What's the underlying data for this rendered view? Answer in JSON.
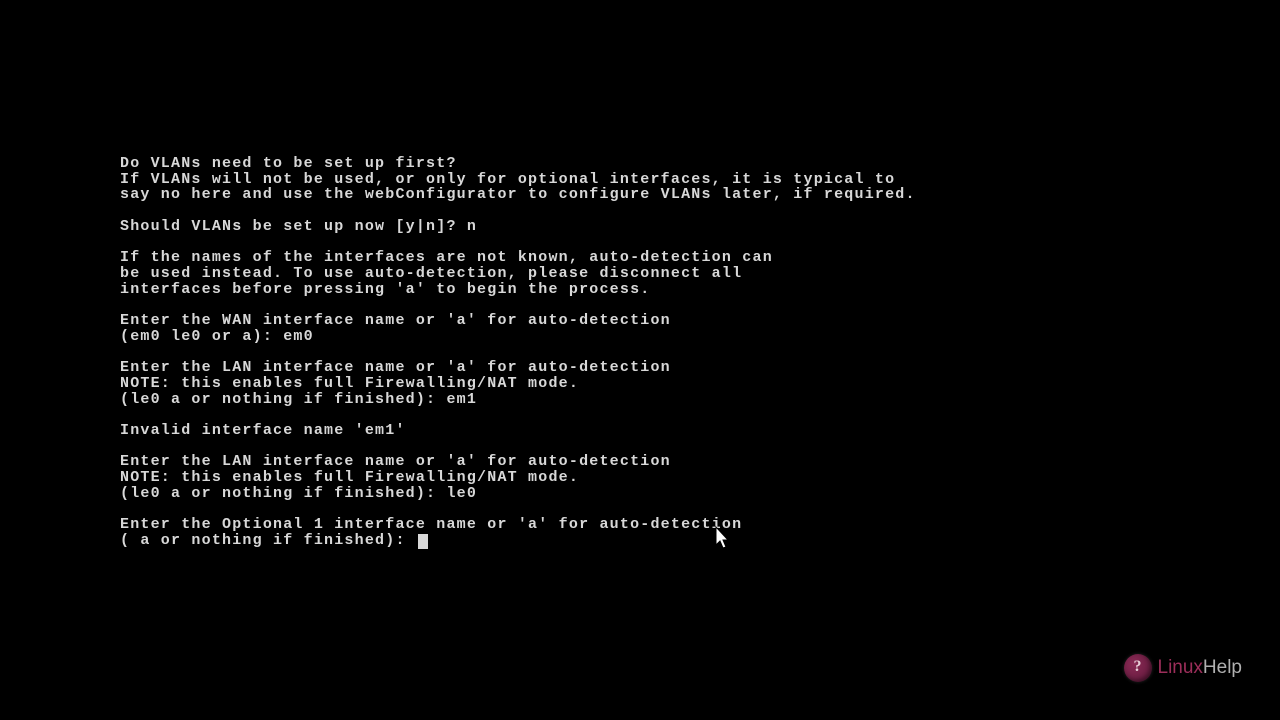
{
  "terminal": {
    "lines": [
      "Do VLANs need to be set up first?",
      "If VLANs will not be used, or only for optional interfaces, it is typical to",
      "say no here and use the webConfigurator to configure VLANs later, if required.",
      "",
      "Should VLANs be set up now [y|n]? n",
      "",
      "If the names of the interfaces are not known, auto-detection can",
      "be used instead. To use auto-detection, please disconnect all",
      "interfaces before pressing 'a' to begin the process.",
      "",
      "Enter the WAN interface name or 'a' for auto-detection",
      "(em0 le0 or a): em0",
      "",
      "Enter the LAN interface name or 'a' for auto-detection",
      "NOTE: this enables full Firewalling/NAT mode.",
      "(le0 a or nothing if finished): em1",
      "",
      "Invalid interface name 'em1'",
      "",
      "Enter the LAN interface name or 'a' for auto-detection",
      "NOTE: this enables full Firewalling/NAT mode.",
      "(le0 a or nothing if finished): le0",
      "",
      "Enter the Optional 1 interface name or 'a' for auto-detection",
      "( a or nothing if finished): "
    ]
  },
  "watermark": {
    "brand_accent": "Linux",
    "brand_rest": "Help"
  }
}
